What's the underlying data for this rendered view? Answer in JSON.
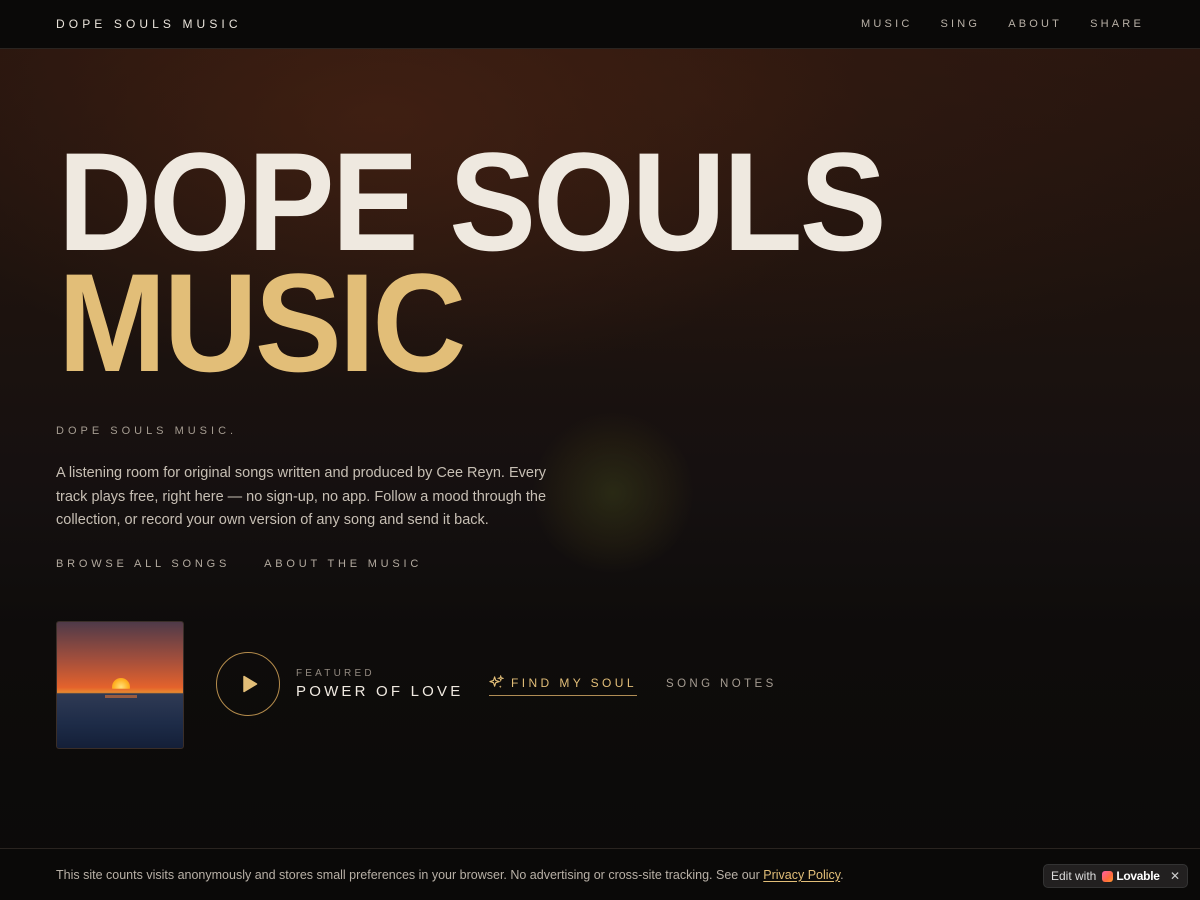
{
  "header": {
    "brand": "DOPE SOULS MUSIC",
    "nav": [
      "MUSIC",
      "SING",
      "ABOUT",
      "SHARE"
    ]
  },
  "hero": {
    "line1": "DOPE SOULS",
    "line2": "MUSIC",
    "eyebrow": "DOPE SOULS MUSIC.",
    "description": "A listening room for original songs written and produced by Cee Reyn. Every track plays free, right here — no sign-up, no app. Follow a mood through the collection, or record your own version of any song and send it back.",
    "links": [
      "BROWSE ALL SONGS",
      "ABOUT THE MUSIC"
    ]
  },
  "featured": {
    "label": "FEATURED",
    "title": "POWER OF LOVE",
    "find_soul": "FIND MY SOUL",
    "song_notes": "SONG NOTES"
  },
  "consent": {
    "text": "This site counts visits anonymously and stores small preferences in your browser. No advertising or cross-site tracking. See our",
    "link": "Privacy Policy",
    "period": "."
  },
  "badge": {
    "edit_with": "Edit with",
    "brand": "Lovable",
    "close": "✕"
  },
  "colors": {
    "accent": "#e2be78",
    "text": "#efe9e0",
    "background": "#0b0908"
  }
}
